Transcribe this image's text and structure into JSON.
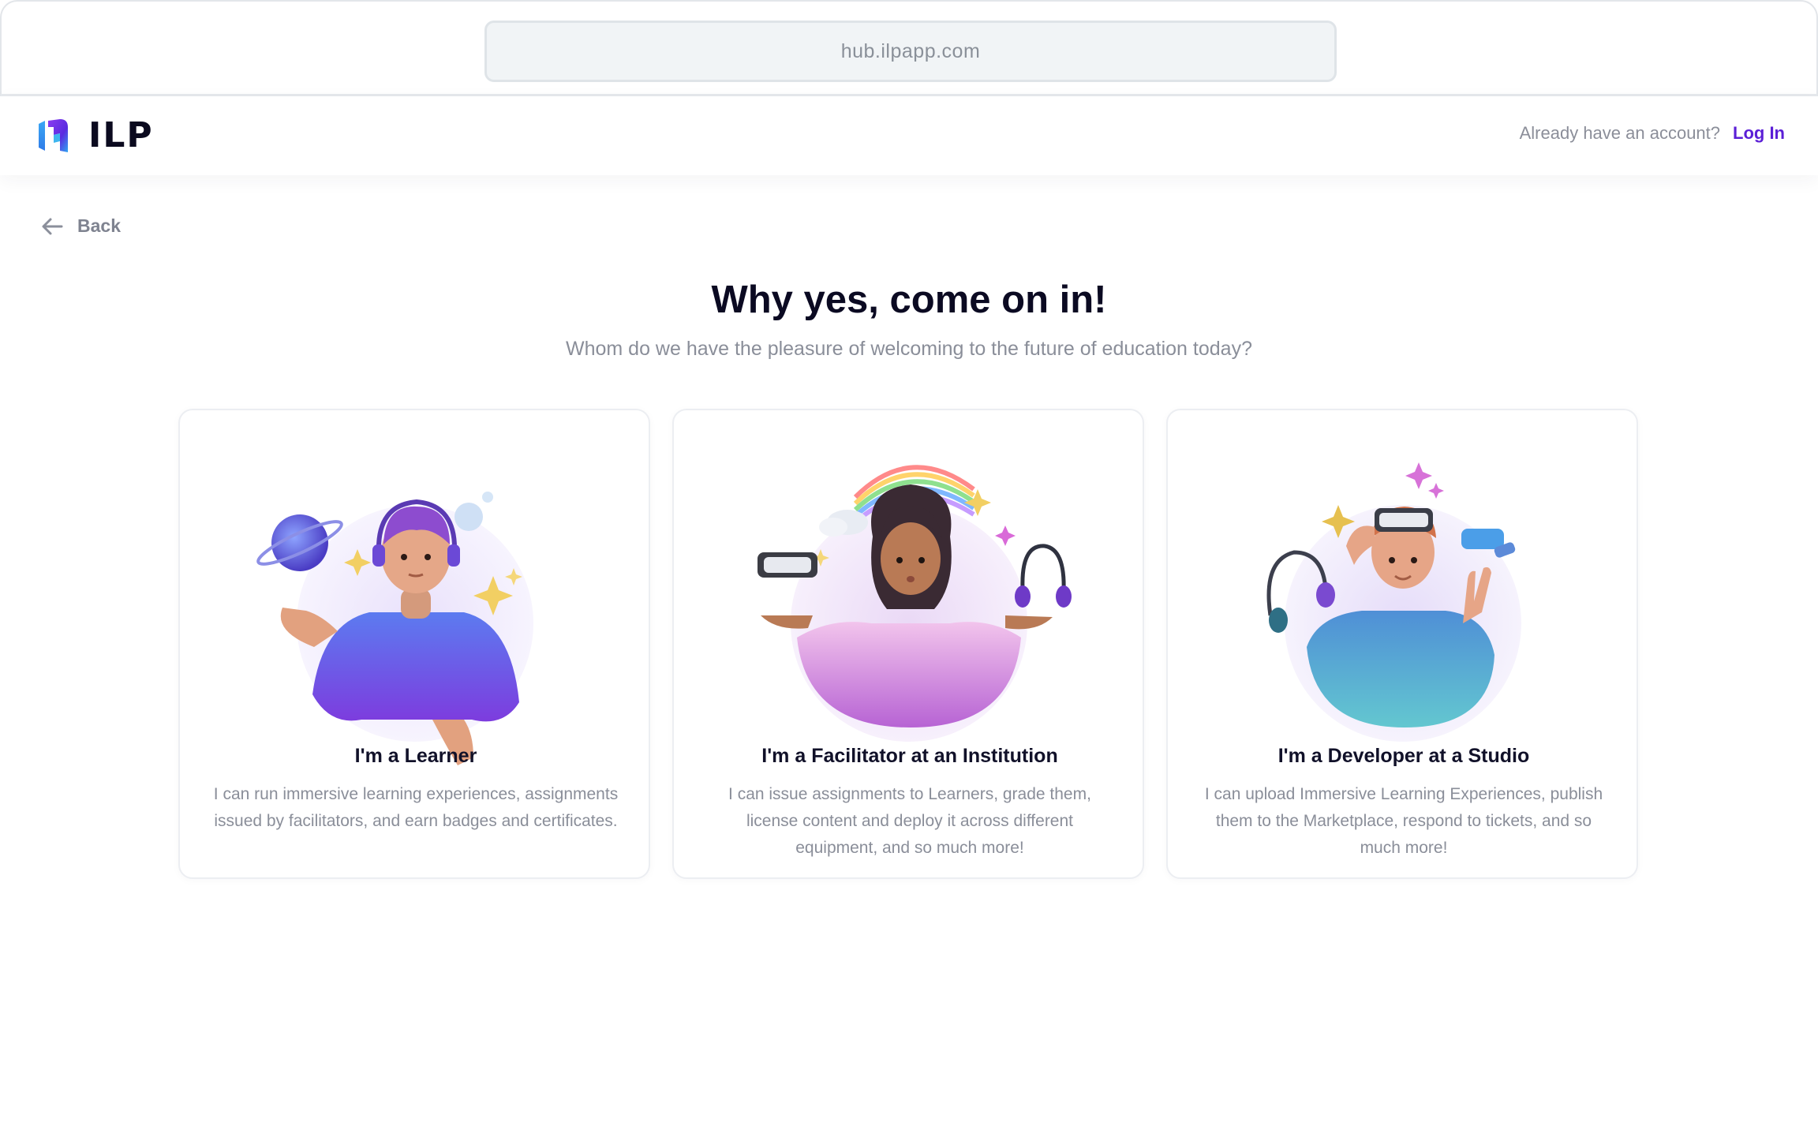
{
  "browser": {
    "url": "hub.ilpapp.com"
  },
  "header": {
    "logo_text": "ILP",
    "account_prompt": "Already have an account?",
    "login_label": "Log In",
    "accent_color": "#5b1fd6"
  },
  "back": {
    "label": "Back"
  },
  "main": {
    "title": "Why yes, come on in!",
    "subtitle": "Whom do we have the pleasure of welcoming to the future of education today?"
  },
  "cards": [
    {
      "title": "I'm a Learner",
      "description": "I can run immersive learning experiences, assignments issued by facilitators, and earn badges and certificates.",
      "illustration": "learner-illustration"
    },
    {
      "title": "I'm a Facilitator at an Institution",
      "description": "I can issue assignments to Learners, grade them, license content and deploy it across different equipment, and so much more!",
      "illustration": "facilitator-illustration"
    },
    {
      "title": "I'm a Developer at a Studio",
      "description": "I can upload Immersive Learning Experiences, publish them to the Marketplace, respond to tickets, and so much more!",
      "illustration": "developer-illustration"
    }
  ]
}
